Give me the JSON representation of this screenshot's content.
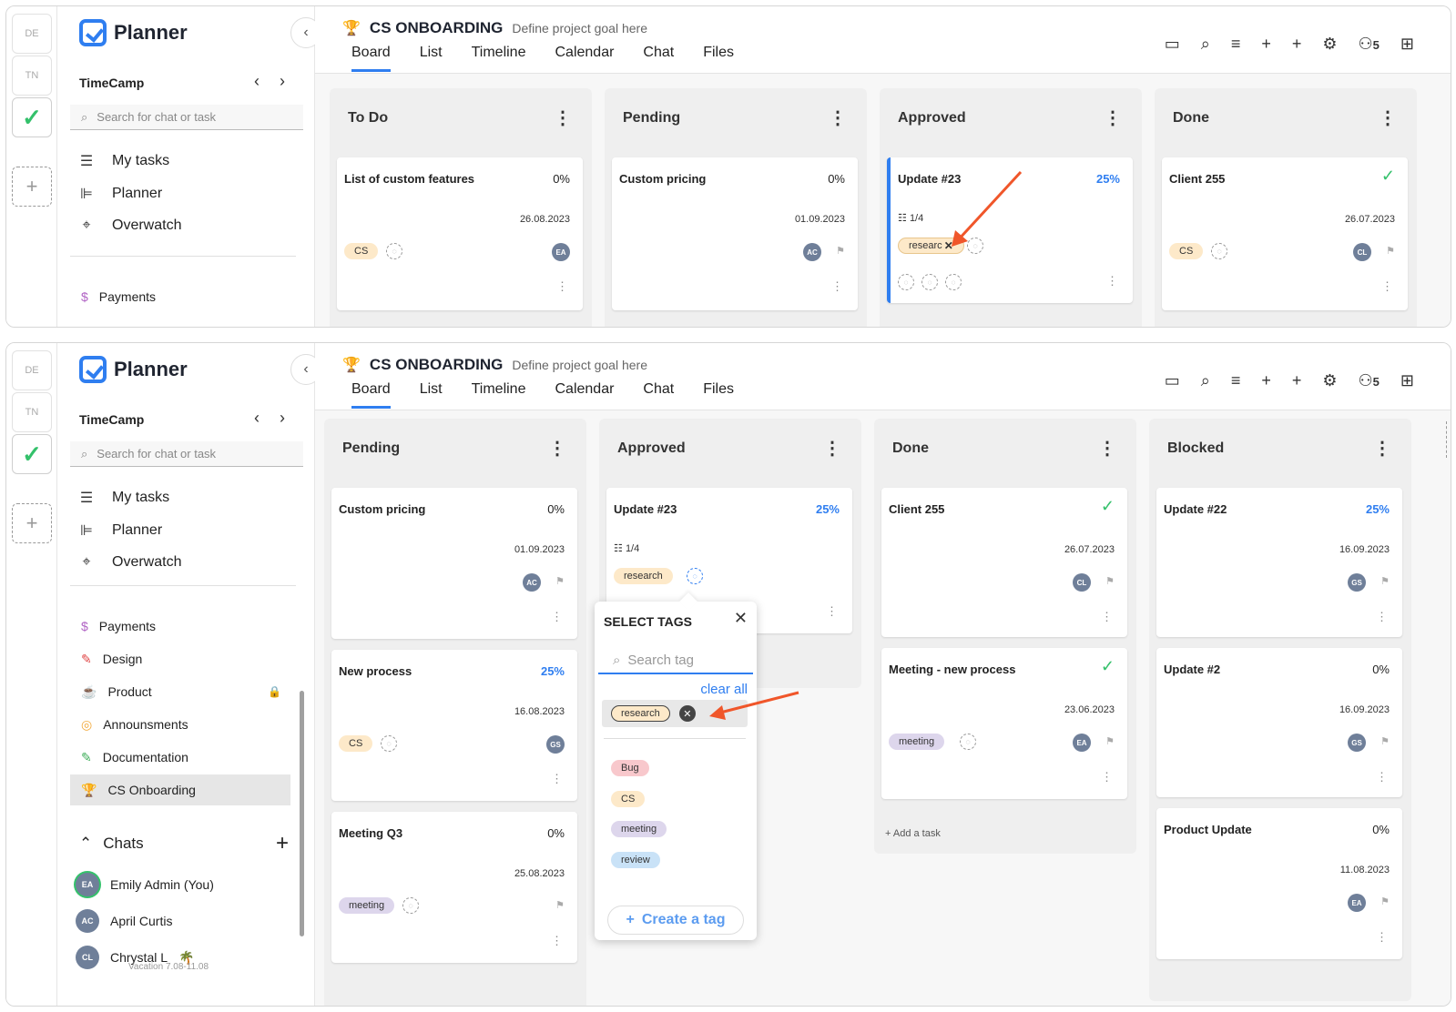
{
  "app": {
    "name": "Planner",
    "org": "TimeCamp",
    "workspaces": [
      "DE",
      "TN"
    ],
    "search_placeholder": "Search for chat or task",
    "nav": [
      {
        "label": "My tasks",
        "icon": "checklist-icon"
      },
      {
        "label": "Planner",
        "icon": "gantt-icon"
      },
      {
        "label": "Overwatch",
        "icon": "telescope-icon"
      }
    ],
    "projects": [
      {
        "label": "Payments",
        "icon": "money-bag-icon"
      },
      {
        "label": "Design",
        "icon": "brush-icon"
      },
      {
        "label": "Product",
        "icon": "coffee-icon",
        "locked": true
      },
      {
        "label": "Announsments",
        "icon": "target-icon"
      },
      {
        "label": "Documentation",
        "icon": "pen-icon"
      },
      {
        "label": "CS Onboarding",
        "icon": "trophy-icon",
        "active": true
      }
    ],
    "chats_label": "Chats",
    "chats": [
      {
        "initials": "EA",
        "name": "Emily Admin (You)"
      },
      {
        "initials": "AC",
        "name": "April Curtis"
      },
      {
        "initials": "CL",
        "name": "Chrystal L",
        "status": "Vacation 7.08-11.08"
      }
    ]
  },
  "project": {
    "title": "CS ONBOARDING",
    "goal": "Define project goal here",
    "tabs": [
      "Board",
      "List",
      "Timeline",
      "Calendar",
      "Chat",
      "Files"
    ],
    "active_tab": "Board",
    "member_count": "5"
  },
  "board_top": {
    "columns": [
      {
        "title": "To Do",
        "cards": [
          {
            "title": "List of custom features",
            "progress": "0%",
            "date": "26.08.2023",
            "tag": "CS",
            "avatar": "EA"
          }
        ]
      },
      {
        "title": "Pending",
        "cards": [
          {
            "title": "Custom pricing",
            "progress": "0%",
            "date": "01.09.2023",
            "avatar": "AC"
          }
        ]
      },
      {
        "title": "Approved",
        "cards": [
          {
            "title": "Update #23",
            "progress": "25%",
            "subtasks": "1/4",
            "tag": "researc",
            "remove_mark": "✕"
          }
        ]
      },
      {
        "title": "Done",
        "cards": [
          {
            "title": "Client 255",
            "progress": "✓",
            "date": "26.07.2023",
            "tag": "CS",
            "avatar": "CL"
          }
        ]
      }
    ]
  },
  "board_bottom": {
    "columns": [
      {
        "title": "Pending",
        "cards": [
          {
            "title": "Custom pricing",
            "progress": "0%",
            "date": "01.09.2023",
            "avatar": "AC"
          },
          {
            "title": "New process",
            "progress": "25%",
            "date": "16.08.2023",
            "tag": "CS",
            "avatar": "GS"
          },
          {
            "title": "Meeting Q3",
            "progress": "0%",
            "date": "25.08.2023",
            "tag": "meeting"
          }
        ]
      },
      {
        "title": "Approved",
        "cards": [
          {
            "title": "Update #23",
            "progress": "25%",
            "subtasks": "1/4",
            "tag": "research"
          }
        ]
      },
      {
        "title": "Done",
        "cards": [
          {
            "title": "Client 255",
            "progress": "✓",
            "date": "26.07.2023",
            "avatar": "CL"
          },
          {
            "title": "Meeting - new process",
            "progress": "✓",
            "date": "23.06.2023",
            "tag": "meeting",
            "avatar": "EA"
          }
        ],
        "add_task": "Add a task"
      },
      {
        "title": "Blocked",
        "cards": [
          {
            "title": "Update #22",
            "progress": "25%",
            "date": "16.09.2023",
            "avatar": "GS"
          },
          {
            "title": "Update #2",
            "progress": "0%",
            "date": "16.09.2023",
            "avatar": "GS"
          },
          {
            "title": "Product Update",
            "progress": "0%",
            "date": "11.08.2023",
            "avatar": "EA"
          }
        ]
      }
    ]
  },
  "tag_popup": {
    "title": "SELECT TAGS",
    "search_placeholder": "Search tag",
    "clear_all": "clear all",
    "selected": "research",
    "tags": [
      "Bug",
      "CS",
      "meeting",
      "review"
    ],
    "create": "Create a tag"
  },
  "colors": {
    "accent": "#2f7ef0",
    "arrow": "#f0562a",
    "done": "#34c16b"
  }
}
